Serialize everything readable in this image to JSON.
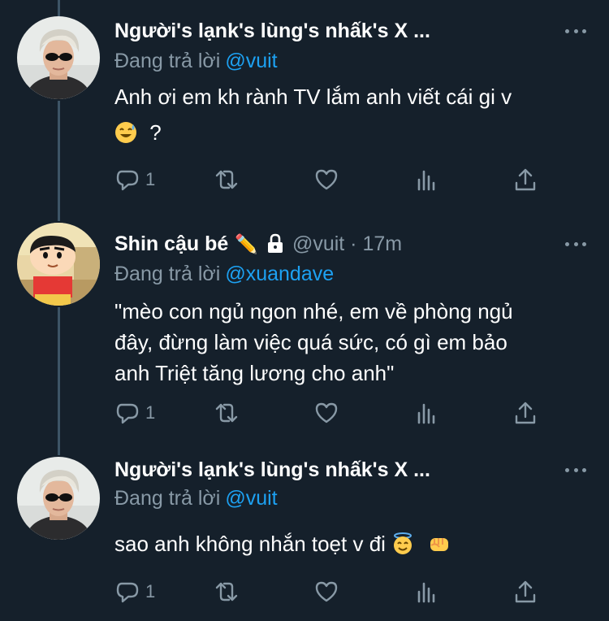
{
  "tweets": [
    {
      "name": "Người's lạnk's lùng's nhấk's X ...",
      "name_extra": "",
      "handle_time": "",
      "reply_label": "Đang trả lời",
      "reply_mention": "@vuit",
      "text_line1": "Anh ơi em kh rành TV lắm anh viết cái gi v",
      "text_line2": "?",
      "reply_count": "1",
      "avatar": "person-sunglasses-avatar"
    },
    {
      "name": "Shin cậu bé",
      "name_extra": "✏️",
      "handle_time": "@vuit · 17m",
      "reply_label": "Đang trả lời",
      "reply_mention": "@xuandave",
      "text_line1": "\"mèo con ngủ ngon nhé, em về phòng ngủ",
      "text_line2": "đây, đừng làm việc quá sức, có gì em bảo",
      "text_line3": "anh Triệt tăng lương cho anh\"",
      "reply_count": "1",
      "avatar": "cartoon-boy-avatar"
    },
    {
      "name": "Người's lạnk's lùng's nhấk's X ...",
      "reply_label": "Đang trả lời",
      "reply_mention": "@vuit",
      "text_line1": "sao anh không nhắn toẹt v đi",
      "reply_count": "1",
      "avatar": "person-sunglasses-avatar"
    }
  ],
  "colors": {
    "background": "#15202b",
    "secondary_text": "#8899a6",
    "link": "#1da1f2",
    "thread_line": "#3d5466"
  }
}
